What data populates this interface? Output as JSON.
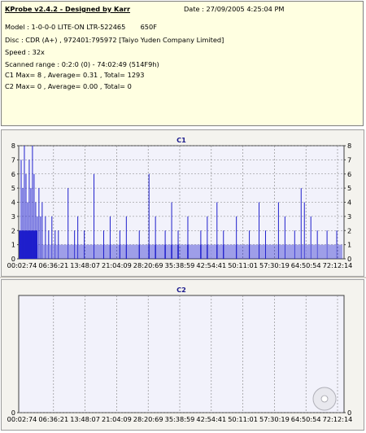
{
  "info": {
    "title": "KProbe v2.4.2 - Designed by Karr",
    "date": "Date : 27/09/2005 4:25:04 PM",
    "model": "Model : 1-0-0-0 LITE-ON LTR-522465       650F",
    "disc": "Disc : CDR (A+) , 972401:795972 [Taiyo Yuden Company Limited]",
    "speed": "Speed : 32x",
    "scanned": "Scanned range : 0:2:0 (0) - 74:02:49 (514F9h)",
    "c1": "C1 Max= 8 , Average= 0.31 , Total= 1293",
    "c2": "C2 Max= 0 , Average= 0.00 , Total= 0"
  },
  "colors": {
    "plot_bg": "#f2f2fb",
    "series": "#1f1fcc",
    "grid": "#808080",
    "title": "#1a1a8c"
  },
  "chart_data": [
    {
      "type": "bar",
      "title": "C1",
      "ylim": [
        0,
        8
      ],
      "yticks": [
        0,
        1,
        2,
        3,
        4,
        5,
        6,
        7,
        8
      ],
      "xticks": [
        "00:02:74",
        "06:36:21",
        "13:48:07",
        "21:04:09",
        "28:20:69",
        "35:38:59",
        "42:54:41",
        "50:11:01",
        "57:30:19",
        "64:50:54",
        "72:12:14"
      ],
      "baseline": 1,
      "peaks": [
        {
          "pos": 0.005,
          "value": 7
        },
        {
          "pos": 0.01,
          "value": 5
        },
        {
          "pos": 0.015,
          "value": 8
        },
        {
          "pos": 0.02,
          "value": 6
        },
        {
          "pos": 0.025,
          "value": 4
        },
        {
          "pos": 0.03,
          "value": 7
        },
        {
          "pos": 0.035,
          "value": 5
        },
        {
          "pos": 0.04,
          "value": 8
        },
        {
          "pos": 0.045,
          "value": 6
        },
        {
          "pos": 0.05,
          "value": 4
        },
        {
          "pos": 0.055,
          "value": 3
        },
        {
          "pos": 0.06,
          "value": 5
        },
        {
          "pos": 0.065,
          "value": 3
        },
        {
          "pos": 0.07,
          "value": 4
        },
        {
          "pos": 0.08,
          "value": 3
        },
        {
          "pos": 0.09,
          "value": 2
        },
        {
          "pos": 0.1,
          "value": 3
        },
        {
          "pos": 0.11,
          "value": 2
        },
        {
          "pos": 0.12,
          "value": 2
        },
        {
          "pos": 0.15,
          "value": 5
        },
        {
          "pos": 0.17,
          "value": 2
        },
        {
          "pos": 0.18,
          "value": 3
        },
        {
          "pos": 0.2,
          "value": 2
        },
        {
          "pos": 0.23,
          "value": 6
        },
        {
          "pos": 0.26,
          "value": 2
        },
        {
          "pos": 0.28,
          "value": 3
        },
        {
          "pos": 0.31,
          "value": 2
        },
        {
          "pos": 0.33,
          "value": 3
        },
        {
          "pos": 0.37,
          "value": 2
        },
        {
          "pos": 0.4,
          "value": 6
        },
        {
          "pos": 0.42,
          "value": 3
        },
        {
          "pos": 0.45,
          "value": 2
        },
        {
          "pos": 0.47,
          "value": 4
        },
        {
          "pos": 0.49,
          "value": 2
        },
        {
          "pos": 0.52,
          "value": 3
        },
        {
          "pos": 0.56,
          "value": 2
        },
        {
          "pos": 0.58,
          "value": 3
        },
        {
          "pos": 0.61,
          "value": 4
        },
        {
          "pos": 0.63,
          "value": 2
        },
        {
          "pos": 0.67,
          "value": 3
        },
        {
          "pos": 0.71,
          "value": 2
        },
        {
          "pos": 0.74,
          "value": 4
        },
        {
          "pos": 0.76,
          "value": 2
        },
        {
          "pos": 0.8,
          "value": 4
        },
        {
          "pos": 0.82,
          "value": 3
        },
        {
          "pos": 0.85,
          "value": 2
        },
        {
          "pos": 0.87,
          "value": 5
        },
        {
          "pos": 0.88,
          "value": 4
        },
        {
          "pos": 0.9,
          "value": 3
        },
        {
          "pos": 0.92,
          "value": 2
        },
        {
          "pos": 0.95,
          "value": 2
        },
        {
          "pos": 0.98,
          "value": 2
        }
      ]
    },
    {
      "type": "bar",
      "title": "C2",
      "ylim": [
        0,
        1
      ],
      "yticks": [
        0
      ],
      "xticks": [
        "00:02:74",
        "06:36:21",
        "13:48:07",
        "21:04:09",
        "28:20:69",
        "35:38:59",
        "42:54:41",
        "50:11:01",
        "57:30:19",
        "64:50:54",
        "72:12:14"
      ],
      "baseline": 0,
      "peaks": []
    }
  ]
}
